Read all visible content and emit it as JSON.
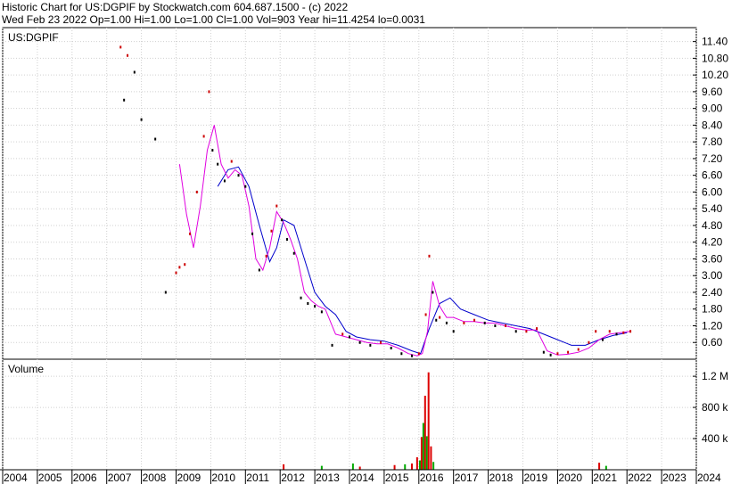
{
  "header": {
    "line1": "Historic Chart for US:DGPIF by Stockwatch.com 604.687.1500 - (c) 2022",
    "line2": "Wed Feb 23 2022   Op=1.00  Hi=1.00  Lo=1.00  Cl=1.00  Vol=903  Year hi=11.4254  lo=0.0031"
  },
  "colors": {
    "up": "#cc0000",
    "down": "#000000",
    "ma_short": "#e000e0",
    "ma_long": "#0000cc",
    "vol_up": "#dd0000",
    "vol_down": "#00aa00",
    "grid": "#d0d0d0",
    "frame": "#000000"
  },
  "chart_data": [
    {
      "type": "line",
      "title": "US:DGPIF",
      "ylim": [
        0.0,
        11.9
      ],
      "y_ticks": [
        0.6,
        1.2,
        1.8,
        2.4,
        3.0,
        3.6,
        4.2,
        4.8,
        5.4,
        6.0,
        6.6,
        7.2,
        7.8,
        8.4,
        9.0,
        9.6,
        10.2,
        10.8,
        11.4
      ],
      "y_tick_labels": [
        "0.60",
        "1.20",
        "1.80",
        "2.40",
        "3.00",
        "3.60",
        "4.20",
        "4.80",
        "5.40",
        "6.00",
        "6.60",
        "7.20",
        "7.80",
        "8.40",
        "9.00",
        "9.60",
        "10.20",
        "10.80",
        "11.40"
      ],
      "price": {
        "x": [
          2007.4,
          2007.5,
          2007.6,
          2007.8,
          2008.0,
          2008.4,
          2008.7,
          2009.0,
          2009.1,
          2009.25,
          2009.4,
          2009.6,
          2009.8,
          2009.95,
          2010.05,
          2010.2,
          2010.4,
          2010.6,
          2010.8,
          2011.0,
          2011.2,
          2011.4,
          2011.6,
          2011.75,
          2011.9,
          2012.05,
          2012.2,
          2012.4,
          2012.6,
          2012.8,
          2013.0,
          2013.2,
          2013.5,
          2013.8,
          2014.0,
          2014.3,
          2014.6,
          2014.9,
          2015.2,
          2015.5,
          2015.8,
          2016.0,
          2016.2,
          2016.3,
          2016.4,
          2016.5,
          2016.6,
          2016.8,
          2017.0,
          2017.3,
          2017.6,
          2017.9,
          2018.2,
          2018.5,
          2018.8,
          2019.1,
          2019.4,
          2019.6,
          2019.8,
          2020.0,
          2020.3,
          2020.6,
          2020.9,
          2021.1,
          2021.3,
          2021.5,
          2021.7,
          2021.9,
          2022.1
        ],
        "y": [
          11.2,
          9.3,
          10.9,
          10.3,
          8.6,
          7.9,
          2.4,
          3.1,
          3.3,
          3.4,
          4.5,
          6.0,
          8.0,
          9.6,
          7.5,
          7.0,
          6.4,
          7.1,
          6.6,
          6.2,
          4.5,
          3.2,
          3.7,
          4.6,
          5.5,
          5.0,
          4.3,
          3.8,
          2.2,
          2.0,
          1.9,
          1.7,
          0.5,
          0.9,
          0.8,
          0.6,
          0.5,
          0.6,
          0.4,
          0.2,
          0.12,
          0.2,
          1.6,
          3.7,
          2.4,
          1.4,
          1.5,
          1.3,
          1.0,
          1.3,
          1.4,
          1.3,
          1.2,
          1.2,
          1.0,
          1.0,
          1.1,
          0.25,
          0.15,
          0.2,
          0.25,
          0.35,
          0.6,
          1.0,
          0.7,
          1.0,
          0.9,
          0.95,
          1.0
        ]
      },
      "ma_short": {
        "x": [
          2009.1,
          2009.3,
          2009.5,
          2009.7,
          2009.9,
          2010.1,
          2010.3,
          2010.5,
          2010.7,
          2010.9,
          2011.1,
          2011.3,
          2011.5,
          2011.7,
          2011.9,
          2012.1,
          2012.3,
          2012.5,
          2012.7,
          2012.9,
          2013.1,
          2013.3,
          2013.6,
          2013.9,
          2014.2,
          2014.5,
          2014.8,
          2015.1,
          2015.4,
          2015.7,
          2015.95,
          2016.1,
          2016.25,
          2016.4,
          2016.6,
          2016.8,
          2017.0,
          2017.3,
          2017.6,
          2017.9,
          2018.2,
          2018.5,
          2018.8,
          2019.1,
          2019.4,
          2019.7,
          2020.0,
          2020.3,
          2020.6,
          2020.9,
          2021.2,
          2021.5,
          2021.8,
          2022.1
        ],
        "y": [
          7.0,
          5.2,
          4.0,
          5.5,
          7.5,
          8.4,
          7.0,
          6.5,
          6.8,
          6.6,
          5.5,
          3.6,
          3.2,
          4.0,
          5.3,
          4.9,
          4.3,
          3.6,
          2.4,
          2.1,
          1.9,
          1.8,
          0.9,
          0.8,
          0.7,
          0.6,
          0.55,
          0.55,
          0.4,
          0.2,
          0.12,
          0.2,
          1.0,
          2.8,
          1.9,
          1.5,
          1.5,
          1.35,
          1.35,
          1.3,
          1.3,
          1.2,
          1.1,
          1.05,
          1.05,
          0.3,
          0.15,
          0.18,
          0.25,
          0.4,
          0.7,
          0.9,
          0.95,
          1.0
        ]
      },
      "ma_long": {
        "x": [
          2010.2,
          2010.5,
          2010.8,
          2011.1,
          2011.4,
          2011.7,
          2011.9,
          2012.1,
          2012.4,
          2012.7,
          2013.0,
          2013.3,
          2013.6,
          2013.9,
          2014.2,
          2014.6,
          2015.0,
          2015.4,
          2015.8,
          2016.05,
          2016.3,
          2016.6,
          2016.9,
          2017.2,
          2017.6,
          2018.0,
          2018.4,
          2018.8,
          2019.2,
          2019.6,
          2020.0,
          2020.4,
          2020.8,
          2021.2,
          2021.6,
          2022.0
        ],
        "y": [
          6.2,
          6.8,
          6.9,
          6.2,
          4.8,
          3.5,
          4.0,
          5.0,
          4.8,
          3.6,
          2.4,
          1.9,
          1.6,
          1.0,
          0.8,
          0.7,
          0.65,
          0.5,
          0.3,
          0.2,
          1.1,
          2.0,
          2.2,
          1.8,
          1.6,
          1.4,
          1.3,
          1.2,
          1.1,
          0.9,
          0.7,
          0.5,
          0.5,
          0.7,
          0.85,
          0.95
        ]
      }
    },
    {
      "type": "bar",
      "title": "Volume",
      "ylim": [
        0,
        1350000
      ],
      "y_ticks": [
        400000,
        800000,
        1200000
      ],
      "y_tick_labels": [
        "400 k",
        "800 k",
        "1.2 M"
      ],
      "bars": [
        {
          "x": 2012.1,
          "v": 70000,
          "up": true
        },
        {
          "x": 2013.2,
          "v": 50000,
          "up": false
        },
        {
          "x": 2014.1,
          "v": 80000,
          "up": false
        },
        {
          "x": 2014.3,
          "v": 40000,
          "up": true
        },
        {
          "x": 2015.3,
          "v": 60000,
          "up": true
        },
        {
          "x": 2015.6,
          "v": 70000,
          "up": false
        },
        {
          "x": 2015.8,
          "v": 80000,
          "up": true
        },
        {
          "x": 2015.95,
          "v": 160000,
          "up": true
        },
        {
          "x": 2016.03,
          "v": 120000,
          "up": false
        },
        {
          "x": 2016.08,
          "v": 420000,
          "up": true
        },
        {
          "x": 2016.13,
          "v": 600000,
          "up": false
        },
        {
          "x": 2016.18,
          "v": 950000,
          "up": true
        },
        {
          "x": 2016.23,
          "v": 430000,
          "up": false
        },
        {
          "x": 2016.28,
          "v": 1250000,
          "up": true
        },
        {
          "x": 2016.35,
          "v": 300000,
          "up": true
        },
        {
          "x": 2016.42,
          "v": 100000,
          "up": false
        },
        {
          "x": 2021.2,
          "v": 90000,
          "up": true
        },
        {
          "x": 2021.4,
          "v": 50000,
          "up": false
        }
      ]
    }
  ],
  "x_axis": {
    "years": [
      2004,
      2005,
      2006,
      2007,
      2008,
      2009,
      2010,
      2011,
      2012,
      2013,
      2014,
      2015,
      2016,
      2017,
      2018,
      2019,
      2020,
      2021,
      2022,
      2023,
      2024
    ],
    "labels": [
      "2004",
      "2005",
      "2006",
      "2007",
      "2008",
      "2009",
      "2010",
      "2011",
      "2012",
      "2013",
      "2014",
      "2015",
      "2016",
      "2017",
      "2018",
      "2019",
      "2020",
      "2021",
      "2022",
      "2023",
      "2024"
    ]
  }
}
